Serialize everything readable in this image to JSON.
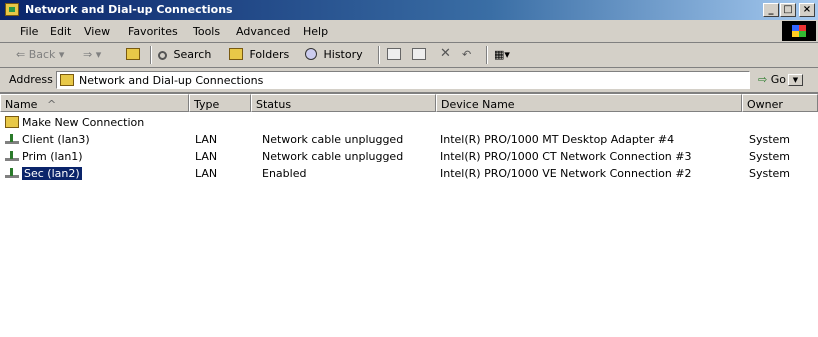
{
  "window": {
    "title": "Network and Dial-up Connections",
    "buttons": [
      "_",
      "□",
      "×"
    ]
  },
  "menu": [
    "File",
    "Edit",
    "View",
    "Favorites",
    "Tools",
    "Advanced",
    "Help"
  ],
  "toolbar": {
    "back": "Back",
    "forward_arrow": "⇒",
    "search": "Search",
    "folders": "Folders",
    "history": "History",
    "views_glyph": "▦▾"
  },
  "address": {
    "label": "Address",
    "value": "Network and Dial-up Connections",
    "go": "Go"
  },
  "columns": [
    "Name",
    "Type",
    "Status",
    "Device Name",
    "Owner"
  ],
  "rows": [
    {
      "name": "Make New Connection",
      "type": "",
      "status": "",
      "device": "",
      "owner": ""
    },
    {
      "name": "Client (lan3)",
      "type": "LAN",
      "status": "Network cable unplugged",
      "device": "Intel(R) PRO/1000 MT Desktop Adapter #4",
      "owner": "System"
    },
    {
      "name": "Prim (lan1)",
      "type": "LAN",
      "status": "Network cable unplugged",
      "device": "Intel(R) PRO/1000 CT Network Connection #3",
      "owner": "System"
    },
    {
      "name": "Sec (lan2)",
      "type": "LAN",
      "status": "Enabled",
      "device": "Intel(R) PRO/1000 VE Network Connection #2",
      "owner": "System"
    }
  ]
}
